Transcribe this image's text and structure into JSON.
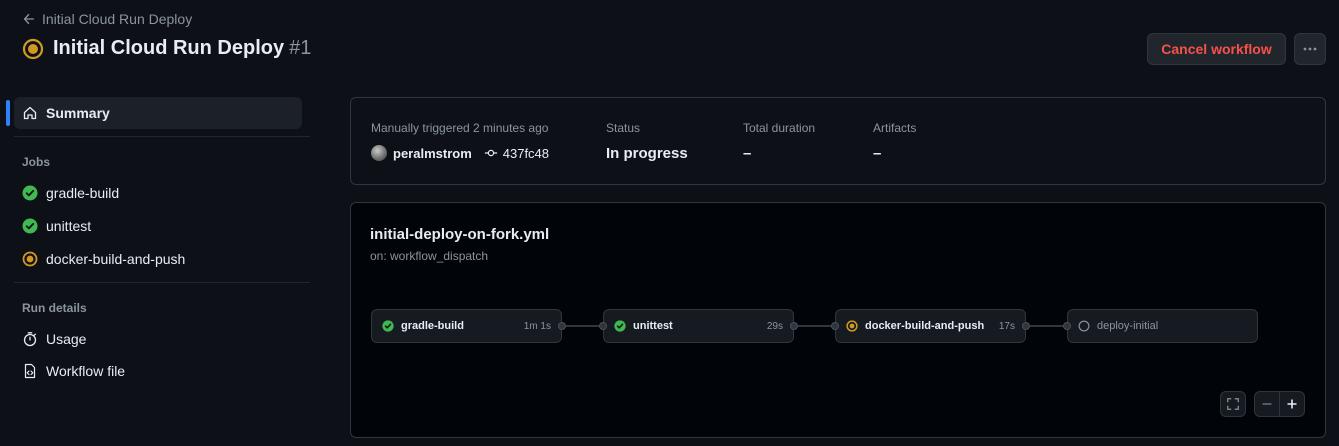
{
  "header": {
    "back_label": "Initial Cloud Run Deploy",
    "title": "Initial Cloud Run Deploy",
    "run_number": "#1",
    "cancel_label": "Cancel workflow",
    "more_icon": "kebab-horizontal-icon"
  },
  "sidebar": {
    "summary_label": "Summary",
    "jobs_heading": "Jobs",
    "jobs": [
      {
        "label": "gradle-build",
        "status": "success"
      },
      {
        "label": "unittest",
        "status": "success"
      },
      {
        "label": "docker-build-and-push",
        "status": "in_progress"
      }
    ],
    "run_details_heading": "Run details",
    "usage_label": "Usage",
    "workflow_file_label": "Workflow file"
  },
  "summary": {
    "trigger_label": "Manually triggered 2 minutes ago",
    "actor": "peralmstrom",
    "commit": "437fc48",
    "status_label": "Status",
    "status_value": "In progress",
    "duration_label": "Total duration",
    "duration_value": "–",
    "artifacts_label": "Artifacts",
    "artifacts_value": "–"
  },
  "graph": {
    "workflow_file": "initial-deploy-on-fork.yml",
    "trigger": "on: workflow_dispatch",
    "jobs": [
      {
        "name": "gradle-build",
        "duration": "1m 1s",
        "status": "success"
      },
      {
        "name": "unittest",
        "duration": "29s",
        "status": "success"
      },
      {
        "name": "docker-build-and-push",
        "duration": "17s",
        "status": "in_progress"
      },
      {
        "name": "deploy-initial",
        "duration": "",
        "status": "pending"
      }
    ]
  },
  "colors": {
    "background": "#0d1117",
    "success": "#3fb950",
    "in_progress": "#d29922",
    "danger": "#f85149",
    "accent": "#2f81f7"
  }
}
